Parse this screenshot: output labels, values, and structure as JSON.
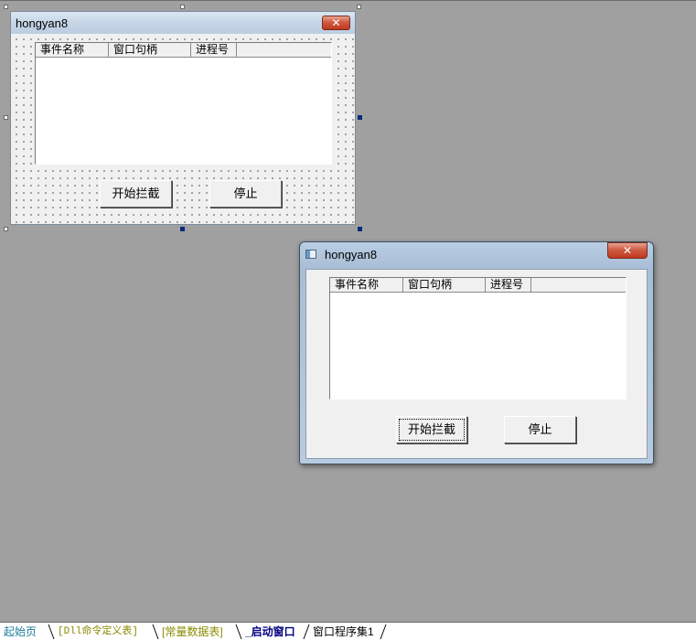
{
  "form": {
    "title": "hongyan8",
    "close_glyph": "✕",
    "columns": [
      "事件名称",
      "窗口句柄",
      "进程号"
    ],
    "start_button": "开始拦截",
    "stop_button": "停止"
  },
  "preview": {
    "title": "hongyan8",
    "close_glyph": "✕",
    "columns": [
      "事件名称",
      "窗口句柄",
      "进程号"
    ],
    "start_button": "开始拦截",
    "stop_button": "停止"
  },
  "tabs": [
    {
      "label": "起始页",
      "color": "#1c7b9c"
    },
    {
      "label": "[Dll命令定义表]",
      "color": "#8a8a00"
    },
    {
      "label": "[常量数据表]",
      "color": "#8a8a00"
    },
    {
      "label": "_启动窗口",
      "color": "#000080",
      "active": true
    },
    {
      "label": "窗口程序集1",
      "color": "#000000"
    }
  ],
  "colors": {
    "workspace": "#a0a0a0",
    "selection_handle": "#0a2a7a"
  }
}
